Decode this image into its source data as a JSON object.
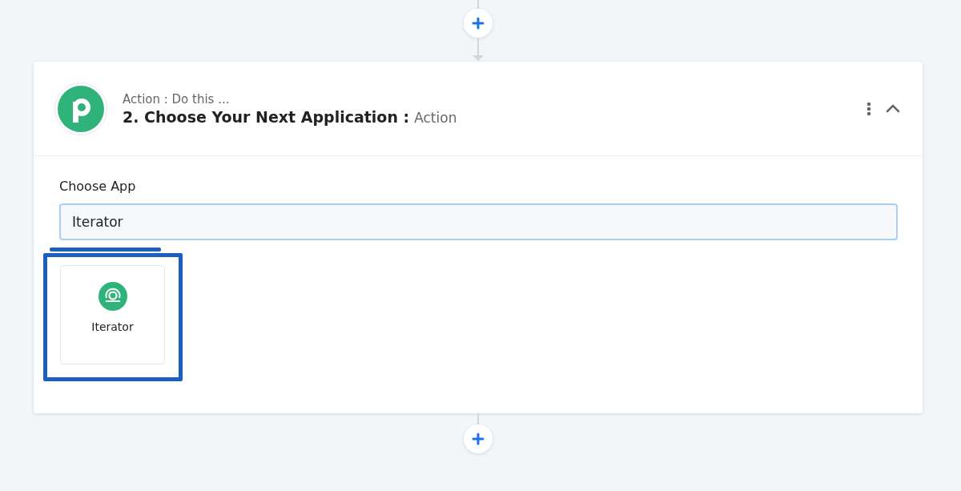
{
  "step": {
    "subtitle": "Action : Do this ...",
    "title": "2. Choose Your Next Application :",
    "title_suffix": "Action"
  },
  "choose_app": {
    "label": "Choose App",
    "value": "Iterator"
  },
  "results": [
    {
      "name": "Iterator"
    }
  ]
}
